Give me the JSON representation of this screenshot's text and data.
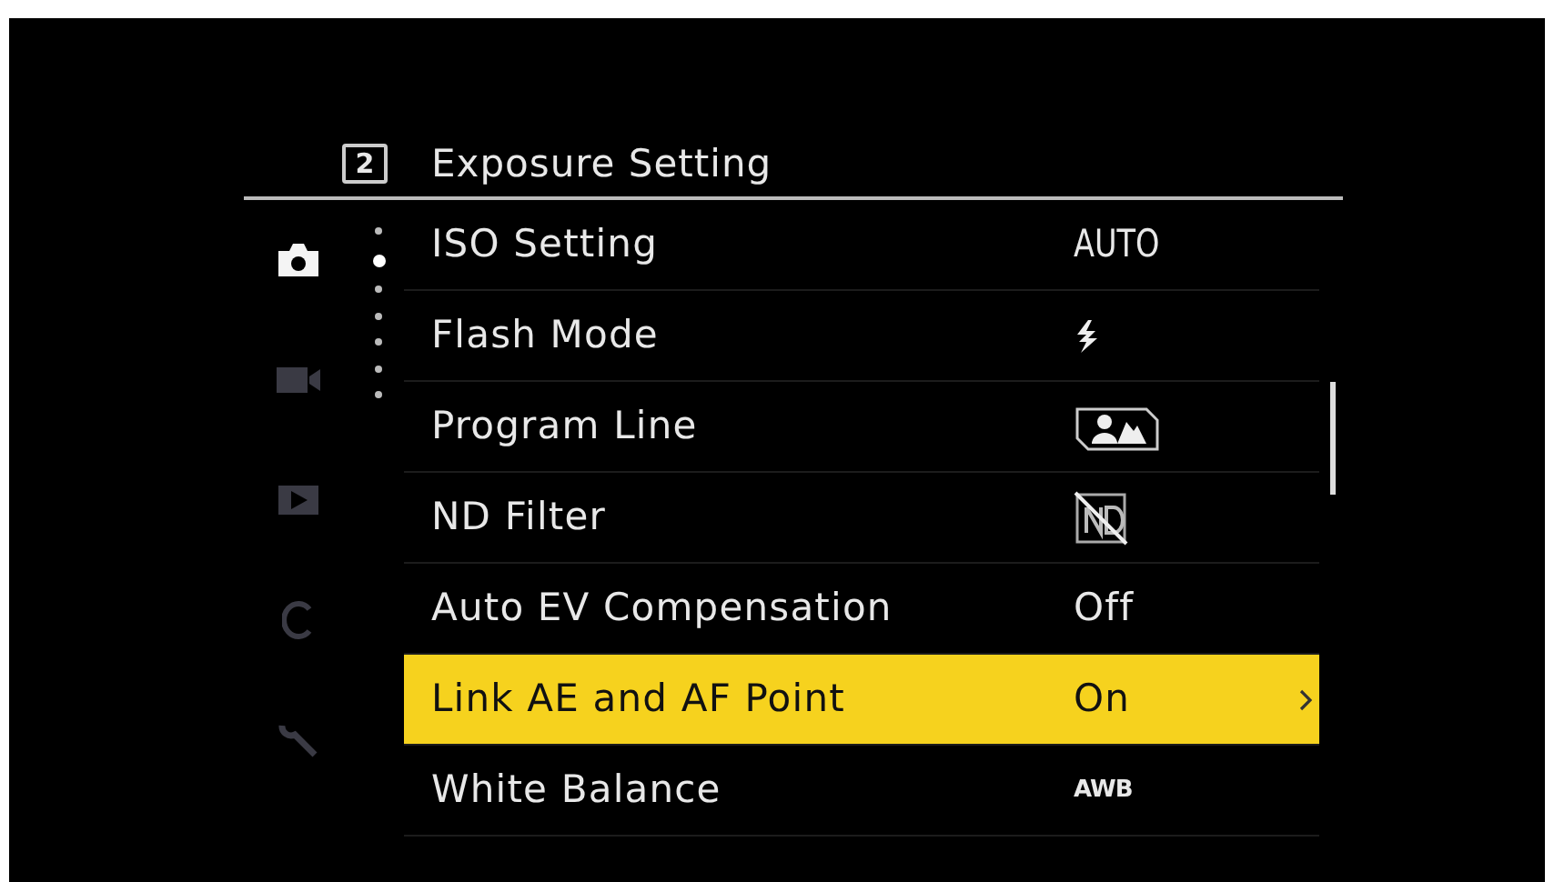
{
  "header": {
    "page_number": "2",
    "title": "Exposure Setting"
  },
  "sidebar_tabs": [
    {
      "kind": "camera",
      "selected": true
    },
    {
      "kind": "movie",
      "selected": false
    },
    {
      "kind": "playback",
      "selected": false
    },
    {
      "kind": "custom",
      "selected": false
    },
    {
      "kind": "setup",
      "selected": false
    }
  ],
  "page_dots": [
    {
      "selected": false
    },
    {
      "selected": true
    },
    {
      "selected": false
    },
    {
      "selected": false
    },
    {
      "selected": false
    },
    {
      "selected": false
    },
    {
      "selected": false
    }
  ],
  "settings": [
    {
      "label": "ISO Setting",
      "kind": "condensed",
      "value": "AUTO",
      "selected": false
    },
    {
      "label": "Flash Mode",
      "kind": "flash",
      "selected": false
    },
    {
      "label": "Program Line",
      "kind": "program",
      "selected": false
    },
    {
      "label": "ND Filter",
      "kind": "nd",
      "selected": false
    },
    {
      "label": "Auto EV Compensation",
      "kind": "text",
      "value": "Off",
      "selected": false
    },
    {
      "label": "Link AE and AF Point",
      "kind": "text",
      "value": "On",
      "selected": true
    },
    {
      "label": "White Balance",
      "kind": "small",
      "value": "AWB",
      "selected": false
    }
  ]
}
